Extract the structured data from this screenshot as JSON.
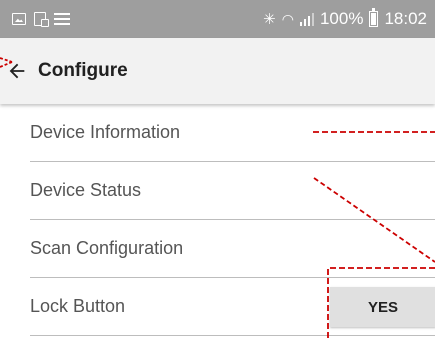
{
  "status_bar": {
    "battery": "100%",
    "time": "18:02",
    "icons": [
      "image-notification-icon",
      "cast-notification-icon",
      "list-notification-icon",
      "bluetooth-icon",
      "wifi-icon",
      "signal-icon",
      "battery-icon"
    ]
  },
  "app_bar": {
    "title": "Configure",
    "back_icon": "arrow-left-icon"
  },
  "settings": {
    "items": [
      {
        "label": "Device Information"
      },
      {
        "label": "Device Status"
      },
      {
        "label": "Scan Configuration"
      },
      {
        "label": "Lock Button",
        "button_label": "YES"
      }
    ]
  },
  "colors": {
    "status_bar_bg": "#9e9e9e",
    "app_bar_bg": "#f2f2f2",
    "annotation_red": "#cc0000",
    "text_primary": "#212121",
    "text_secondary": "#555555"
  }
}
